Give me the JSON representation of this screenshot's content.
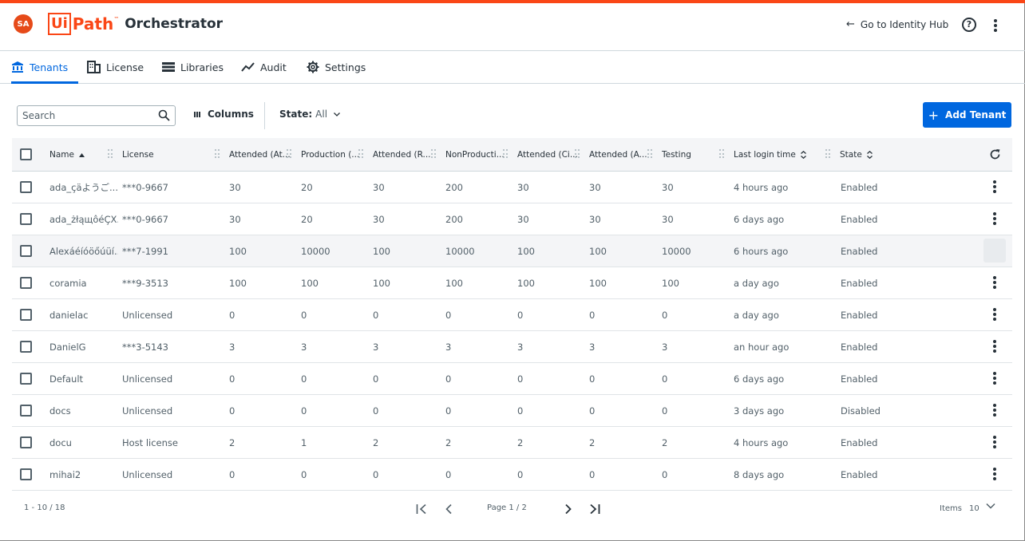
{
  "header": {
    "avatar": "SA",
    "logo_ui": "Ui",
    "logo_path": "Path",
    "logo_tm": "™",
    "product": "Orchestrator",
    "identity_link": "Go to Identity Hub",
    "help": "?"
  },
  "tabs": [
    {
      "label": "Tenants",
      "active": true
    },
    {
      "label": "License"
    },
    {
      "label": "Libraries"
    },
    {
      "label": "Audit"
    },
    {
      "label": "Settings"
    }
  ],
  "toolbar": {
    "search_placeholder": "Search",
    "columns_label": "Columns",
    "state_label": "State:",
    "state_value": "All",
    "add_label": "Add Tenant",
    "add_plus": "+"
  },
  "table": {
    "columns": [
      "Name",
      "License",
      "Attended (At...",
      "Production (...",
      "Attended (R...",
      "NonProducti...",
      "Attended (Ci...",
      "Attended (A...",
      "Testing",
      "Last login time",
      "State"
    ],
    "rows": [
      [
        "ada_çäようご...",
        "***0-9667",
        "30",
        "20",
        "30",
        "200",
        "30",
        "30",
        "30",
        "4 hours ago",
        "Enabled"
      ],
      [
        "ada_żłąщôéÇX...",
        "***0-9667",
        "30",
        "20",
        "30",
        "200",
        "30",
        "30",
        "30",
        "6 days ago",
        "Enabled"
      ],
      [
        "Alexáéíóöőúüí...",
        "***7-1991",
        "100",
        "10000",
        "100",
        "10000",
        "100",
        "100",
        "10000",
        "6 hours ago",
        "Enabled"
      ],
      [
        "coramia",
        "***9-3513",
        "100",
        "100",
        "100",
        "100",
        "100",
        "100",
        "100",
        "a day ago",
        "Enabled"
      ],
      [
        "danielac",
        "Unlicensed",
        "0",
        "0",
        "0",
        "0",
        "0",
        "0",
        "0",
        "a day ago",
        "Enabled"
      ],
      [
        "DanielG",
        "***3-5143",
        "3",
        "3",
        "3",
        "3",
        "3",
        "3",
        "3",
        "an hour ago",
        "Enabled"
      ],
      [
        "Default",
        "Unlicensed",
        "0",
        "0",
        "0",
        "0",
        "0",
        "0",
        "0",
        "6 days ago",
        "Enabled"
      ],
      [
        "docs",
        "Unlicensed",
        "0",
        "0",
        "0",
        "0",
        "0",
        "0",
        "0",
        "3 days ago",
        "Disabled"
      ],
      [
        "docu",
        "Host license",
        "2",
        "1",
        "2",
        "2",
        "2",
        "2",
        "2",
        "4 hours ago",
        "Enabled"
      ],
      [
        "mihai2",
        "Unlicensed",
        "0",
        "0",
        "0",
        "0",
        "0",
        "0",
        "0",
        "8 days ago",
        "Enabled"
      ]
    ]
  },
  "footer": {
    "range": "1 - 10 / 18",
    "page_info": "Page 1 / 2",
    "items_label": "Items",
    "items_value": "10"
  },
  "colors": {
    "accent": "#0067df",
    "brand": "#fa4616"
  }
}
